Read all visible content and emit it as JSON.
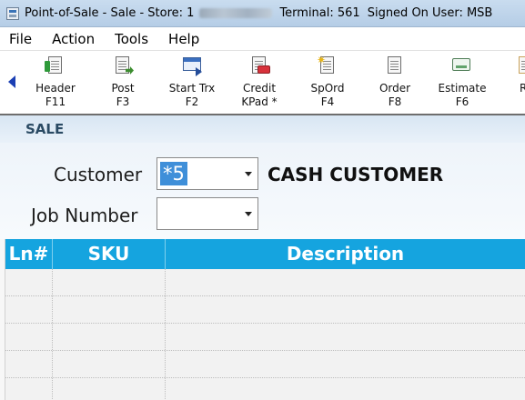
{
  "window": {
    "title_prefix": "Point-of-Sale - Sale  -  Store: 1",
    "terminal": "Terminal: 561",
    "user": "Signed On User: MSB"
  },
  "menu": [
    "File",
    "Action",
    "Tools",
    "Help"
  ],
  "toolbar": {
    "buttons": [
      {
        "label": "Header",
        "shortcut": "F11",
        "icon": "header-doc-icon"
      },
      {
        "label": "Post",
        "shortcut": "F3",
        "icon": "post-doc-icon"
      },
      {
        "label": "Start Trx",
        "shortcut": "F2",
        "icon": "start-trx-icon"
      },
      {
        "label": "Credit",
        "shortcut": "KPad *",
        "icon": "credit-card-icon"
      },
      {
        "label": "SpOrd",
        "shortcut": "F4",
        "icon": "special-order-icon"
      },
      {
        "label": "Order",
        "shortcut": "F8",
        "icon": "order-doc-icon"
      },
      {
        "label": "Estimate",
        "shortcut": "F6",
        "icon": "estimate-icon"
      },
      {
        "label": "R",
        "shortcut": "",
        "icon": "partial-doc-icon"
      }
    ]
  },
  "sale": {
    "header": "SALE",
    "customer_label": "Customer",
    "customer_value": "*5",
    "customer_name": "CASH CUSTOMER",
    "job_label": "Job Number",
    "job_value": ""
  },
  "grid": {
    "columns": [
      "Ln#",
      "SKU",
      "Description"
    ],
    "rows": 5
  },
  "colors": {
    "grid_header": "#15a4df",
    "selection": "#3f8fd9",
    "sale_label": "#2a4a63"
  }
}
